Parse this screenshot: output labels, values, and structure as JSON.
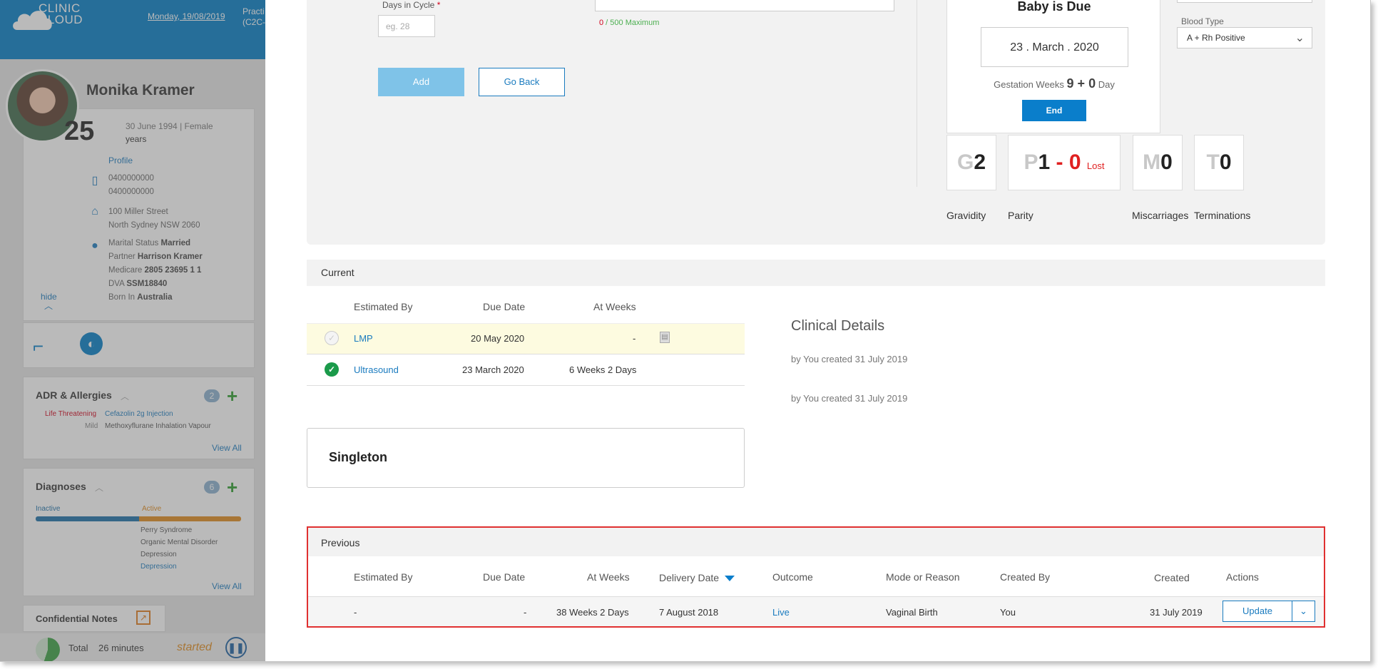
{
  "header": {
    "logo_text": "CLINIC\nCLOUD",
    "date": "Monday, 19/08/2019",
    "practice": "Practi\n(C2C-"
  },
  "patient": {
    "name": "Monika Kramer",
    "age": "25",
    "age_unit": "years",
    "dob_sex": "30 June 1994 | Female",
    "profile_link": "Profile",
    "phone_1": "0400000000",
    "phone_2": "0400000000",
    "address_1": "100 Miller Street",
    "address_2": "North Sydney NSW 2060",
    "marital_label": "Marital Status",
    "marital_value": "Married",
    "partner_label": "Partner",
    "partner_value": "Harrison Kramer",
    "medicare_label": "Medicare",
    "medicare_value": "2805 23695 1 1",
    "dva_label": "DVA",
    "dva_value": "SSM18840",
    "born_label": "Born In",
    "born_value": "Australia",
    "hide_link": "hide"
  },
  "adr": {
    "title": "ADR & Allergies",
    "count": "2",
    "items": [
      {
        "severity": "Life Threatening",
        "name": "Cefazolin 2g Injection"
      },
      {
        "severity": "Mild",
        "name": "Methoxyflurane Inhalation Vapour"
      }
    ],
    "view_all": "View All"
  },
  "diagnoses": {
    "title": "Diagnoses",
    "count": "6",
    "inactive_label": "Inactive",
    "active_label": "Active",
    "items": [
      "Perry Syndrome",
      "Organic Mental Disorder",
      "Depression",
      "Depression"
    ],
    "view_all": "View All"
  },
  "confidential": {
    "title": "Confidential Notes"
  },
  "timer": {
    "label": "Total",
    "duration": "26 minutes",
    "status": "started"
  },
  "form": {
    "days_in_cycle_label": "Days in Cycle",
    "required_mark": "*",
    "days_placeholder": "eg. 28",
    "counter_zero": "0",
    "counter_rest": " / 500 Maximum",
    "add_label": "Add",
    "back_label": "Go Back"
  },
  "due": {
    "title": "Baby is Due",
    "date": "23 . March . 2020",
    "gest_label": "Gestation Weeks",
    "gest_value": "9 + 0",
    "gest_unit": "Day",
    "end_label": "End"
  },
  "blood": {
    "label": "Blood Type",
    "value": "A + Rh Positive"
  },
  "stats": {
    "g_letter": "G",
    "g_value": "2",
    "g_label": "Gravidity",
    "p_letter": "P",
    "p_value": "1",
    "p_dash": " - ",
    "p_lost_value": "0",
    "p_lost_label": "Lost",
    "p_label": "Parity",
    "m_letter": "M",
    "m_value": "0",
    "m_label": "Miscarriages",
    "t_letter": "T",
    "t_value": "0",
    "t_label": "Terminations"
  },
  "current": {
    "title": "Current",
    "columns": [
      "Estimated By",
      "Due Date",
      "At Weeks"
    ],
    "rows": [
      {
        "estimated_by": "LMP",
        "due_date": "20 May 2020",
        "at_weeks": "-"
      },
      {
        "estimated_by": "Ultrasound",
        "due_date": "23 March 2020",
        "at_weeks": "6 Weeks 2 Days"
      }
    ]
  },
  "clinical": {
    "title": "Clinical Details",
    "lines": [
      "by You created 31 July 2019",
      "by You created 31 July 2019"
    ]
  },
  "singleton": {
    "label": "Singleton"
  },
  "previous": {
    "title": "Previous",
    "columns": [
      "Estimated By",
      "Due Date",
      "At Weeks",
      "Delivery Date",
      "Outcome",
      "Mode or Reason",
      "Created By",
      "Created",
      "Actions"
    ],
    "row": {
      "estimated_by": "-",
      "due_date": "-",
      "at_weeks": "38 Weeks 2 Days",
      "delivery_date": "7 August 2018",
      "outcome": "Live",
      "mode": "Vaginal Birth",
      "created_by": "You",
      "created": "31 July 2019",
      "update_label": "Update"
    }
  },
  "colors": {
    "brand": "#007cc7",
    "highlight_row": "#fdfbe0",
    "alert": "#e03030"
  }
}
